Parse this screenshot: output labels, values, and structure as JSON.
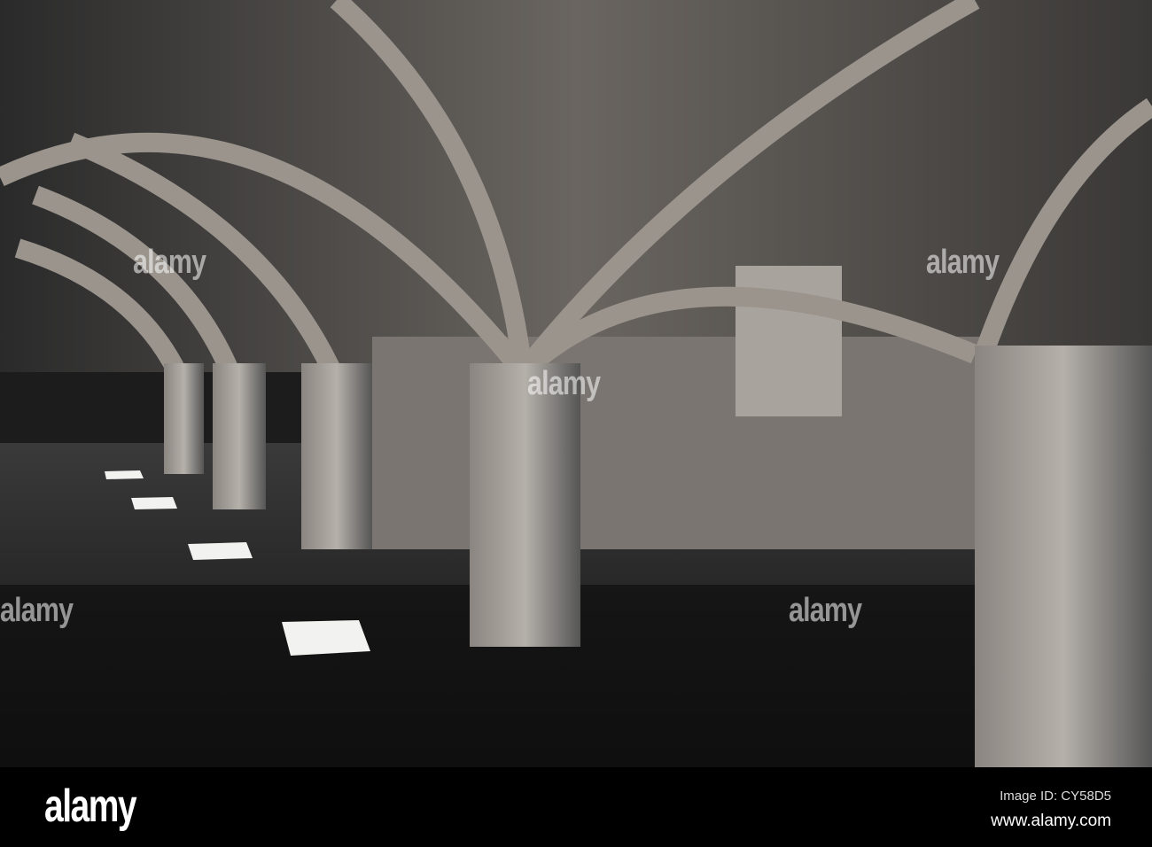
{
  "photo": {
    "subject": "vaulted stone undercroft with arches and pillars"
  },
  "watermark": {
    "text": "alamy"
  },
  "footer": {
    "logo": "alamy",
    "image_id": "Image ID: CY58D5",
    "website": "www.alamy.com"
  }
}
